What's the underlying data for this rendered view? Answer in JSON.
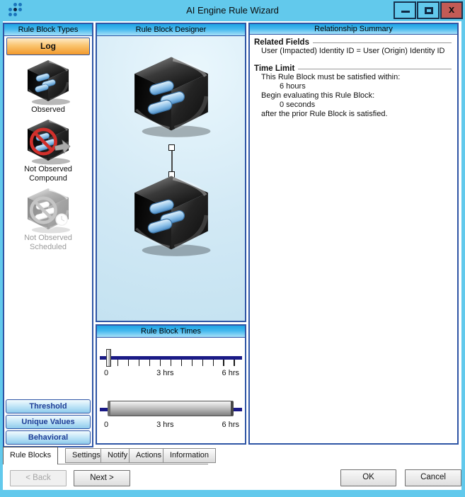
{
  "window": {
    "title": "AI Engine Rule Wizard",
    "close_glyph": "x"
  },
  "left_panel": {
    "header": "Rule Block Types",
    "selected_type": "Log",
    "items": [
      {
        "icon": "observed-cube-icon",
        "label_line1": "Observed",
        "label_line2": ""
      },
      {
        "icon": "not-observed-compound-cube-icon",
        "label_line1": "Not Observed",
        "label_line2": "Compound"
      },
      {
        "icon": "not-observed-scheduled-cube-icon",
        "label_line1": "Not Observed",
        "label_line2": "Scheduled"
      }
    ],
    "type_buttons": [
      "Threshold",
      "Unique Values",
      "Behavioral"
    ]
  },
  "designer": {
    "header": "Rule Block Designer",
    "block1_icon": "rule-block-cube-icon",
    "block2_icon": "rule-block-cube-icon",
    "connector_icon": "block-link-connector"
  },
  "times": {
    "header": "Rule Block Times",
    "begin_slider": {
      "labels": [
        "0",
        "3 hrs",
        "6 hrs"
      ],
      "value": "0"
    },
    "within_slider": {
      "labels": [
        "0",
        "3 hrs",
        "6 hrs"
      ],
      "value": "6 hrs"
    }
  },
  "summary": {
    "header": "Relationship Summary",
    "related_fields": {
      "title": "Related Fields",
      "value": "User (Impacted) Identity ID = User (Origin) Identity ID"
    },
    "time_limit": {
      "title": "Time Limit",
      "line1": "This Rule Block must be satisfied within:",
      "value1": "6 hours",
      "line2": "Begin evaluating this Rule Block:",
      "value2": "0 seconds",
      "line3": "after the prior Rule Block is satisfied."
    }
  },
  "tabs": {
    "items": [
      "Rule Blocks",
      "Settings",
      "Notify",
      "Actions",
      "Information"
    ],
    "active": "Rule Blocks"
  },
  "actions": {
    "back": "< Back",
    "next": "Next >",
    "ok": "OK",
    "cancel": "Cancel"
  },
  "colors": {
    "titlebar_cyan": "#62C9EC",
    "header_blue": "#1FA5E4",
    "panel_border_navy": "#2E55A5",
    "slider_navy": "#1A1A86",
    "log_orange": "#F2992B",
    "close_red": "#C35B55",
    "prohibit_red": "#D2302C"
  }
}
